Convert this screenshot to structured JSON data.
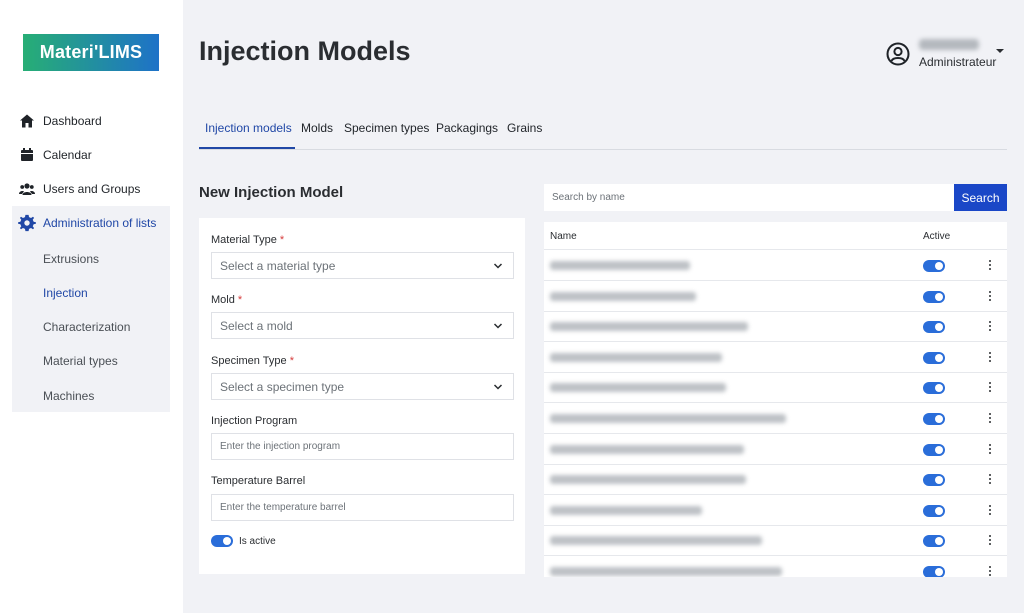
{
  "app": {
    "logo_text": "Materi'LIMS",
    "brand_colors": [
      "#27ae75",
      "#1e72c8"
    ]
  },
  "sidebar": {
    "items": [
      {
        "label": "Dashboard",
        "icon": "home-icon"
      },
      {
        "label": "Calendar",
        "icon": "calendar-icon"
      },
      {
        "label": "Users and Groups",
        "icon": "users-icon"
      }
    ],
    "admin": {
      "label": "Administration of lists",
      "icon": "gear-icon"
    },
    "subitems": [
      "Extrusions",
      "Injection",
      "Characterization",
      "Material types",
      "Machines"
    ],
    "active_subitem": "Injection"
  },
  "header": {
    "title": "Injection Models",
    "user_role": "Administrateur"
  },
  "tabs": [
    "Injection models",
    "Molds",
    "Specimen types",
    "Packagings",
    "Grains"
  ],
  "active_tab": "Injection models",
  "form": {
    "title": "New Injection Model",
    "material_type": {
      "label": "Material Type",
      "required": "*",
      "placeholder": "Select a material type"
    },
    "mold": {
      "label": "Mold",
      "required": "*",
      "placeholder": "Select a mold"
    },
    "specimen_type": {
      "label": "Specimen Type",
      "required": "*",
      "placeholder": "Select a specimen type"
    },
    "injection_program": {
      "label": "Injection Program",
      "placeholder": "Enter the injection program"
    },
    "temperature_barrel": {
      "label": "Temperature Barrel",
      "placeholder": "Enter the temperature barrel"
    },
    "is_active": {
      "label": "Is active",
      "value": true
    }
  },
  "search": {
    "placeholder": "Search by name",
    "button_label": "Search"
  },
  "table": {
    "columns": [
      "Name",
      "Active"
    ],
    "rows": [
      {
        "active": true
      },
      {
        "active": true
      },
      {
        "active": true
      },
      {
        "active": true
      },
      {
        "active": true
      },
      {
        "active": true
      },
      {
        "active": true
      },
      {
        "active": true
      },
      {
        "active": true
      },
      {
        "active": true
      },
      {
        "active": true
      }
    ]
  },
  "colors": {
    "accent": "#2047a6",
    "button": "#1a47c7",
    "toggle_on": "#2a6dd9"
  }
}
